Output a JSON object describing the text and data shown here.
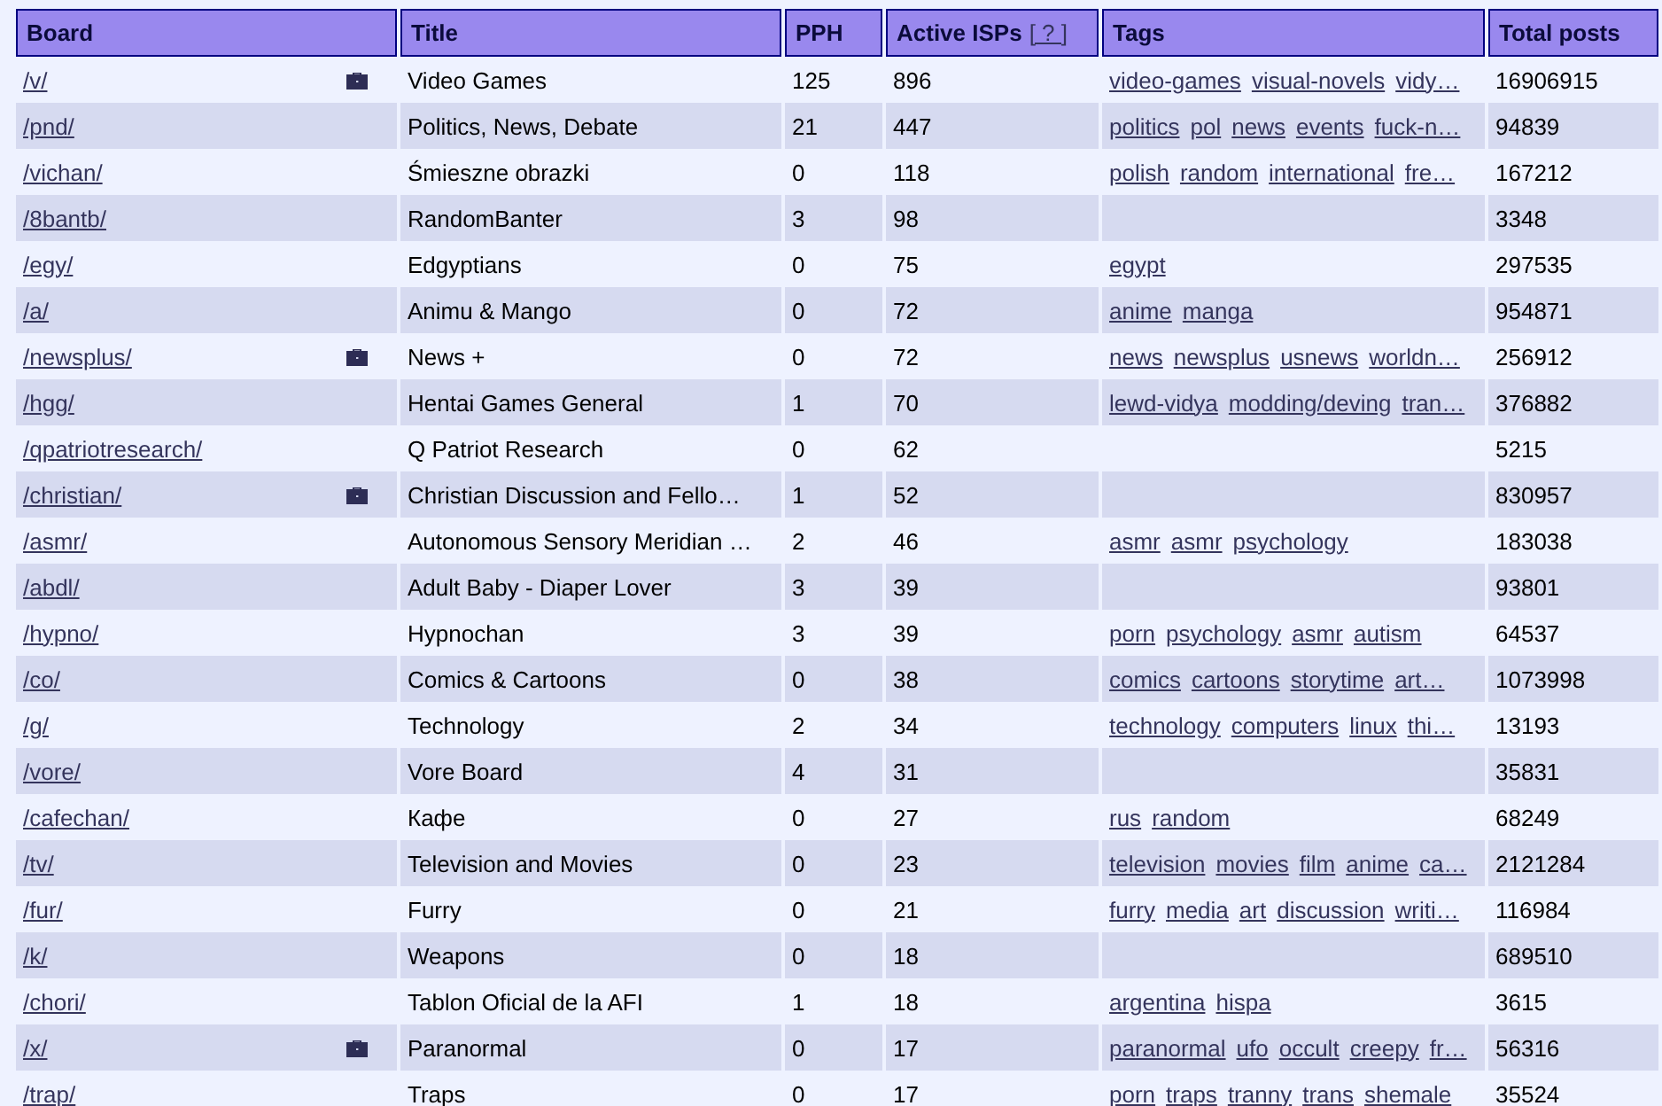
{
  "table": {
    "columns": [
      {
        "label": "Board"
      },
      {
        "label": "Title"
      },
      {
        "label": "PPH"
      },
      {
        "label": "Active ISPs",
        "link": "[ ? ]"
      },
      {
        "label": "Tags"
      },
      {
        "label": "Total posts"
      }
    ],
    "rows": [
      {
        "board": "/v/",
        "marked": true,
        "title": "Video Games",
        "pph": "125",
        "isps": "896",
        "tags": [
          "video-games",
          "visual-novels",
          "vidy…"
        ],
        "total": "16906915"
      },
      {
        "board": "/pnd/",
        "marked": false,
        "title": "Politics, News, Debate",
        "pph": "21",
        "isps": "447",
        "tags": [
          "politics",
          "pol",
          "news",
          "events",
          "fuck-n…"
        ],
        "total": "94839"
      },
      {
        "board": "/vichan/",
        "marked": false,
        "title": "Śmieszne obrazki",
        "pph": "0",
        "isps": "118",
        "tags": [
          "polish",
          "random",
          "international",
          "fre…"
        ],
        "total": "167212"
      },
      {
        "board": "/8bantb/",
        "marked": false,
        "title": "RandomBanter",
        "pph": "3",
        "isps": "98",
        "tags": [],
        "total": "3348"
      },
      {
        "board": "/egy/",
        "marked": false,
        "title": "Edgyptians",
        "pph": "0",
        "isps": "75",
        "tags": [
          "egypt"
        ],
        "total": "297535"
      },
      {
        "board": "/a/",
        "marked": false,
        "title": "Animu & Mango",
        "pph": "0",
        "isps": "72",
        "tags": [
          "anime",
          "manga"
        ],
        "total": "954871"
      },
      {
        "board": "/newsplus/",
        "marked": true,
        "title": "News +",
        "pph": "0",
        "isps": "72",
        "tags": [
          "news",
          "newsplus",
          "usnews",
          "worldn…"
        ],
        "total": "256912"
      },
      {
        "board": "/hgg/",
        "marked": false,
        "title": "Hentai Games General",
        "pph": "1",
        "isps": "70",
        "tags": [
          "lewd-vidya",
          "modding/deving",
          "tran…"
        ],
        "total": "376882"
      },
      {
        "board": "/qpatriotresearch/",
        "marked": false,
        "title": "Q Patriot Research",
        "pph": "0",
        "isps": "62",
        "tags": [],
        "total": "5215"
      },
      {
        "board": "/christian/",
        "marked": true,
        "title": "Christian Discussion and Fello…",
        "pph": "1",
        "isps": "52",
        "tags": [],
        "total": "830957"
      },
      {
        "board": "/asmr/",
        "marked": false,
        "title": "Autonomous Sensory Meridian …",
        "pph": "2",
        "isps": "46",
        "tags": [
          "asmr",
          "asmr",
          "psychology"
        ],
        "total": "183038"
      },
      {
        "board": "/abdl/",
        "marked": false,
        "title": "Adult Baby - Diaper Lover",
        "pph": "3",
        "isps": "39",
        "tags": [],
        "total": "93801"
      },
      {
        "board": "/hypno/",
        "marked": false,
        "title": "Hypnochan",
        "pph": "3",
        "isps": "39",
        "tags": [
          "porn",
          "psychology",
          "asmr",
          "autism"
        ],
        "total": "64537"
      },
      {
        "board": "/co/",
        "marked": false,
        "title": "Comics & Cartoons",
        "pph": "0",
        "isps": "38",
        "tags": [
          "comics",
          "cartoons",
          "storytime",
          "art…"
        ],
        "total": "1073998"
      },
      {
        "board": "/g/",
        "marked": false,
        "title": "Technology",
        "pph": "2",
        "isps": "34",
        "tags": [
          "technology",
          "computers",
          "linux",
          "thi…"
        ],
        "total": "13193"
      },
      {
        "board": "/vore/",
        "marked": false,
        "title": "Vore Board",
        "pph": "4",
        "isps": "31",
        "tags": [],
        "total": "35831"
      },
      {
        "board": "/cafechan/",
        "marked": false,
        "title": "Кафе",
        "pph": "0",
        "isps": "27",
        "tags": [
          "rus",
          "random"
        ],
        "total": "68249"
      },
      {
        "board": "/tv/",
        "marked": false,
        "title": "Television and Movies",
        "pph": "0",
        "isps": "23",
        "tags": [
          "television",
          "movies",
          "film",
          "anime",
          "ca…"
        ],
        "total": "2121284"
      },
      {
        "board": "/fur/",
        "marked": false,
        "title": "Furry",
        "pph": "0",
        "isps": "21",
        "tags": [
          "furry",
          "media",
          "art",
          "discussion",
          "writi…"
        ],
        "total": "116984"
      },
      {
        "board": "/k/",
        "marked": false,
        "title": "Weapons",
        "pph": "0",
        "isps": "18",
        "tags": [],
        "total": "689510"
      },
      {
        "board": "/chori/",
        "marked": false,
        "title": "Tablon Oficial de la AFI",
        "pph": "1",
        "isps": "18",
        "tags": [
          "argentina",
          "hispa"
        ],
        "total": "3615"
      },
      {
        "board": "/x/",
        "marked": true,
        "title": "Paranormal",
        "pph": "0",
        "isps": "17",
        "tags": [
          "paranormal",
          "ufo",
          "occult",
          "creepy",
          "fr…"
        ],
        "total": "56316"
      },
      {
        "board": "/trap/",
        "marked": false,
        "title": "Traps",
        "pph": "0",
        "isps": "17",
        "tags": [
          "porn",
          "traps",
          "tranny",
          "trans",
          "shemale"
        ],
        "total": "35524"
      }
    ]
  }
}
